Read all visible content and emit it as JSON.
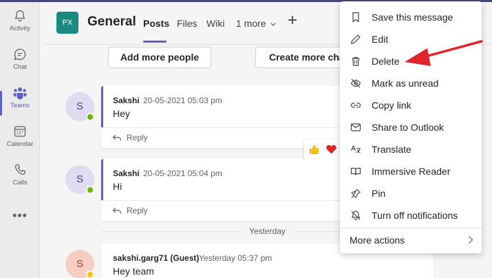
{
  "rail": {
    "items": [
      {
        "label": "Activity",
        "icon": "bell-icon"
      },
      {
        "label": "Chat",
        "icon": "chat-icon"
      },
      {
        "label": "Teams",
        "icon": "teams-icon",
        "active": true
      },
      {
        "label": "Calendar",
        "icon": "calendar-icon"
      },
      {
        "label": "Calls",
        "icon": "phone-icon"
      }
    ],
    "more": "•••"
  },
  "header": {
    "team_initials": "PX",
    "channel_title": "General",
    "tabs": [
      "Posts",
      "Files",
      "Wiki",
      "1 more"
    ],
    "active_tab": "Posts",
    "add_tab_symbol": "+"
  },
  "actions": {
    "add_people": "Add more people",
    "create_more": "Create more cha"
  },
  "messages": [
    {
      "avatar": "S",
      "author": "Sakshi",
      "time": "20-05-2021 05:03 pm",
      "text": "Hey",
      "reply": "Reply",
      "presence": "online"
    },
    {
      "avatar": "S",
      "author": "Sakshi",
      "time": "20-05-2021 05:04 pm",
      "text": "Hi",
      "reply": "Reply",
      "presence": "online"
    },
    {
      "avatar": "S",
      "author": "sakshi.garg71 (Guest)",
      "time": "Yesterday 05:37 pm",
      "text": "Hey team",
      "presence": "away"
    }
  ],
  "day_separator": "Yesterday",
  "reactions": [
    "thumbs-up-icon",
    "heart-icon"
  ],
  "menu": {
    "items": [
      {
        "label": "Save this message",
        "icon": "bookmark-icon"
      },
      {
        "label": "Edit",
        "icon": "pencil-icon"
      },
      {
        "label": "Delete",
        "icon": "trash-icon"
      },
      {
        "label": "Mark as unread",
        "icon": "eye-off-icon"
      },
      {
        "label": "Copy link",
        "icon": "link-icon"
      },
      {
        "label": "Share to Outlook",
        "icon": "mail-icon"
      },
      {
        "label": "Translate",
        "icon": "translate-icon"
      },
      {
        "label": "Immersive Reader",
        "icon": "reader-icon"
      },
      {
        "label": "Pin",
        "icon": "pin-icon"
      },
      {
        "label": "Turn off notifications",
        "icon": "bell-off-icon"
      }
    ],
    "more_actions": "More actions"
  },
  "colors": {
    "accent": "#5b5fc7",
    "team_avatar": "#1b8a81",
    "annotation_arrow": "#e0242c",
    "presence_online": "#6bb700",
    "presence_away": "#f8c400"
  }
}
